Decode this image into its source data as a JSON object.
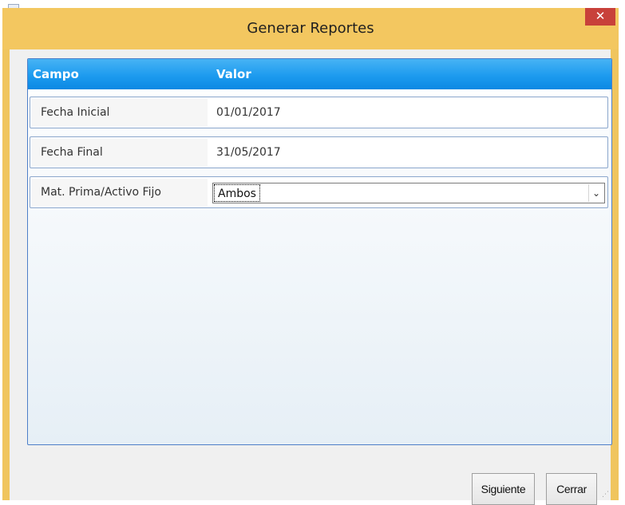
{
  "window": {
    "title": "Generar Reportes",
    "close_glyph": "✕"
  },
  "grid": {
    "headers": {
      "campo": "Campo",
      "valor": "Valor"
    },
    "rows": [
      {
        "label": "Fecha Inicial",
        "value": "01/01/2017"
      },
      {
        "label": "Fecha Final",
        "value": "31/05/2017"
      },
      {
        "label": "Mat. Prima/Activo Fijo",
        "value": "Ambos"
      }
    ],
    "select_arrow_glyph": "⌄"
  },
  "buttons": {
    "next_label": "Siguiente",
    "close_label": "Cerrar"
  },
  "colors": {
    "title_bar": "#f3c760",
    "close_button": "#c8413a",
    "grid_header": "#1d9bef",
    "grid_border": "#4e7fc8"
  },
  "icons": {
    "close": "close-icon",
    "dropdown": "chevron-down-icon",
    "resize": "resize-grip-icon"
  }
}
